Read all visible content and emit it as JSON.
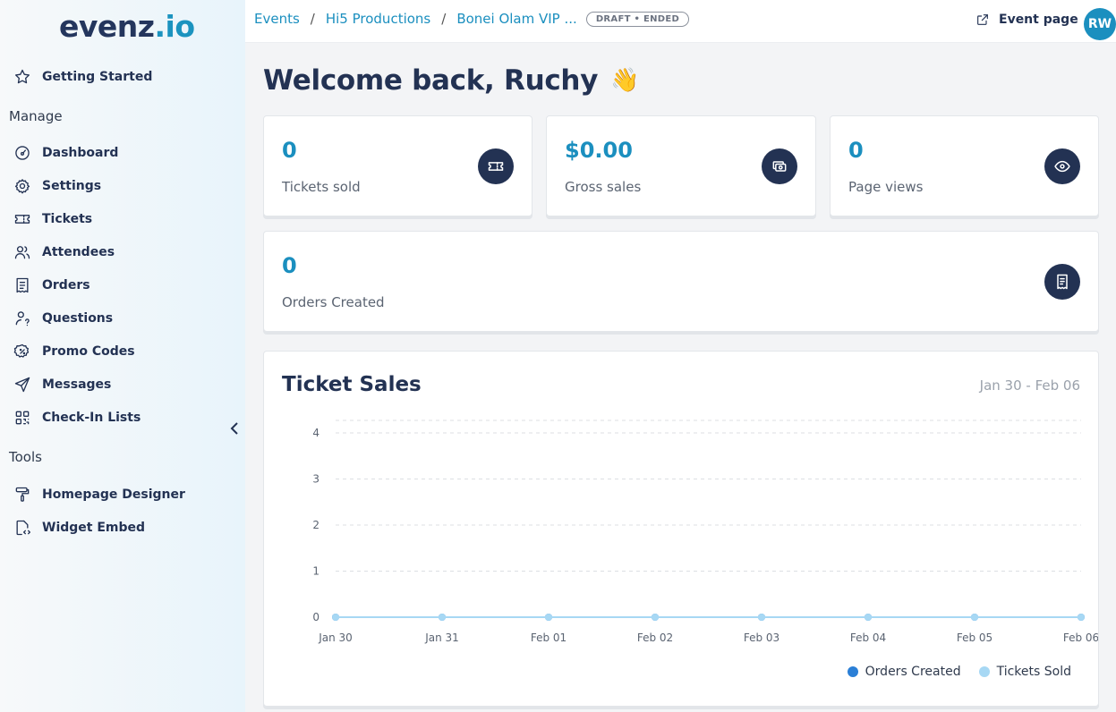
{
  "brand": {
    "part1": "evenz",
    "part2": ".io"
  },
  "sidebar": {
    "getting_started": "Getting Started",
    "manage_label": "Manage",
    "manage_items": [
      {
        "label": "Dashboard",
        "icon": "gauge-icon"
      },
      {
        "label": "Settings",
        "icon": "gear-icon"
      },
      {
        "label": "Tickets",
        "icon": "ticket-icon"
      },
      {
        "label": "Attendees",
        "icon": "users-icon"
      },
      {
        "label": "Orders",
        "icon": "receipt-icon"
      },
      {
        "label": "Questions",
        "icon": "user-question-icon"
      },
      {
        "label": "Promo Codes",
        "icon": "discount-icon"
      },
      {
        "label": "Messages",
        "icon": "send-icon"
      },
      {
        "label": "Check-In Lists",
        "icon": "qrcode-icon"
      }
    ],
    "tools_label": "Tools",
    "tools_items": [
      {
        "label": "Homepage Designer",
        "icon": "paint-roller-icon"
      },
      {
        "label": "Widget Embed",
        "icon": "code-file-icon"
      }
    ]
  },
  "header": {
    "breadcrumbs": [
      "Events",
      "Hi5 Productions",
      "Bonei Olam VIP ..."
    ],
    "status_badge": "DRAFT • ENDED",
    "event_page_label": "Event page",
    "avatar_initials": "RW"
  },
  "main": {
    "welcome": "Welcome back, Ruchy",
    "wave_emoji": "👋",
    "stats": [
      {
        "value": "0",
        "label": "Tickets sold",
        "icon": "ticket-icon"
      },
      {
        "value": "$0.00",
        "label": "Gross sales",
        "icon": "cash-icon"
      },
      {
        "value": "0",
        "label": "Page views",
        "icon": "eye-icon"
      },
      {
        "value": "0",
        "label": "Orders Created",
        "icon": "receipt-icon"
      }
    ],
    "chart_title": "Ticket Sales",
    "chart_range": "Jan 30 - Feb 06"
  },
  "colors": {
    "accent": "#1b8fbf",
    "navy": "#233253",
    "orders_series": "#2b7fd6",
    "tickets_series": "#a7d8f4"
  },
  "chart_data": {
    "type": "line",
    "title": "Ticket Sales",
    "x": [
      "Jan 30",
      "Jan 31",
      "Feb 01",
      "Feb 02",
      "Feb 03",
      "Feb 04",
      "Feb 05",
      "Feb 06"
    ],
    "yticks": [
      0,
      1,
      2,
      3,
      4
    ],
    "ylim": [
      0,
      4
    ],
    "grid": true,
    "legend_position": "bottom-right",
    "series": [
      {
        "name": "Orders Created",
        "values": [
          0,
          0,
          0,
          0,
          0,
          0,
          0,
          0
        ]
      },
      {
        "name": "Tickets Sold",
        "values": [
          0,
          0,
          0,
          0,
          0,
          0,
          0,
          0
        ]
      }
    ]
  }
}
